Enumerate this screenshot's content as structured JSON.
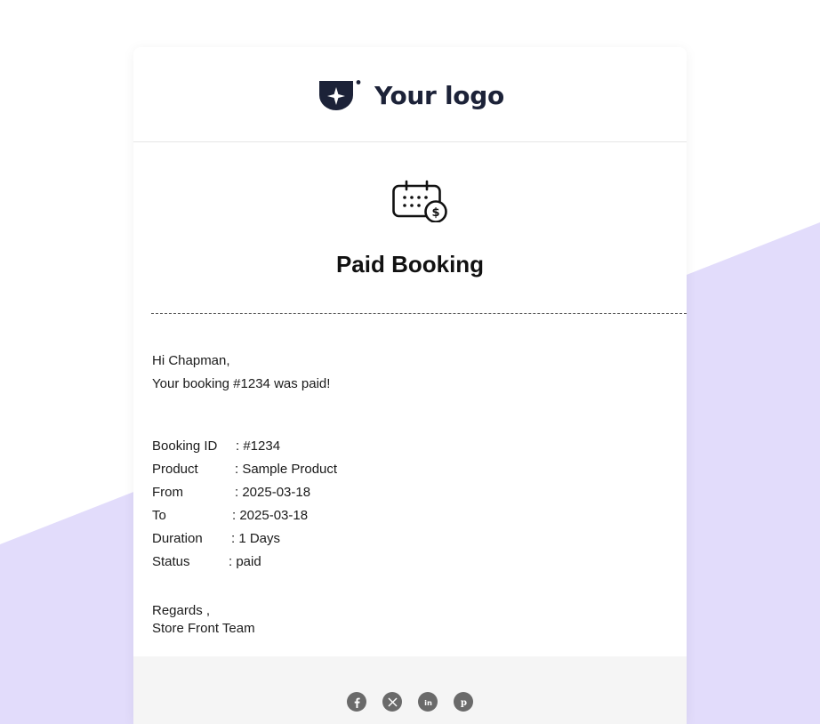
{
  "brand": {
    "logo_text": "Your logo",
    "logo_color": "#1c2238"
  },
  "hero": {
    "icon": "calendar-dollar-icon",
    "title": "Paid Booking"
  },
  "message": {
    "greeting": "Hi Chapman,",
    "line": "Your booking #1234 was paid!"
  },
  "details": [
    {
      "label": "Booking ID",
      "value": ": #1234"
    },
    {
      "label": "Product",
      "value": ": Sample Product"
    },
    {
      "label": "From",
      "value": ": 2025-03-18"
    },
    {
      "label": "To",
      "value": ": 2025-03-18"
    },
    {
      "label": "Duration",
      "value": ": 1 Days"
    },
    {
      "label": "Status",
      "value": ": paid"
    }
  ],
  "signature": {
    "regards": "Regards ,",
    "team": "Store Front Team"
  },
  "footer": {
    "social_icons": [
      "facebook-icon",
      "x-twitter-icon",
      "linkedin-icon",
      "pinterest-icon"
    ]
  },
  "colors": {
    "background_accent": "#e2dcfb",
    "footer_bg": "#f5f5f5",
    "social_icon_bg": "#6a6a6a"
  }
}
